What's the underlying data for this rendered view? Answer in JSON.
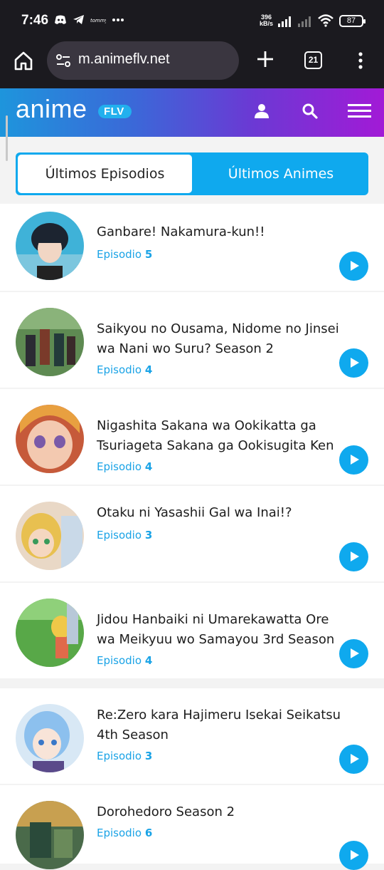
{
  "status_bar": {
    "time": "7:46",
    "icons": [
      "discord-icon",
      "telegram-icon",
      "app-icon",
      "more-dots-icon"
    ],
    "net_speed_value": "396",
    "net_speed_unit": "kB/s",
    "battery": "87"
  },
  "browser": {
    "url": "m.animeflv.net",
    "tab_count": "21"
  },
  "site": {
    "logo_text": "anime",
    "logo_badge": "FLV"
  },
  "tabs": {
    "latest_episodes": "Últimos Episodios",
    "latest_animes": "Últimos Animes"
  },
  "episodes": [
    {
      "title": "Ganbare! Nakamura-kun!!",
      "ep_label": "Episodio",
      "ep_num": "5"
    },
    {
      "title": "Saikyou no Ousama, Nidome no Jinsei wa Nani wo Suru? Season 2",
      "ep_label": "Episodio",
      "ep_num": "4"
    },
    {
      "title": "Nigashita Sakana wa Ookikatta ga Tsuriageta Sakana ga Ookisugita Ken",
      "ep_label": "Episodio",
      "ep_num": "4"
    },
    {
      "title": "Otaku ni Yasashii Gal wa Inai!?",
      "ep_label": "Episodio",
      "ep_num": "3"
    },
    {
      "title": "Jidou Hanbaiki ni Umarekawatta Ore wa Meikyuu wo Samayou 3rd Season",
      "ep_label": "Episodio",
      "ep_num": "4"
    },
    {
      "title": "Re:Zero kara Hajimeru Isekai Seikatsu 4th Season",
      "ep_label": "Episodio",
      "ep_num": "3"
    },
    {
      "title": "Dorohedoro Season 2",
      "ep_label": "Episodio",
      "ep_num": "6"
    }
  ],
  "colors": {
    "accent": "#0fa9ee",
    "episode_text": "#1aa3e6",
    "browser_bg": "#1b1a1f"
  }
}
